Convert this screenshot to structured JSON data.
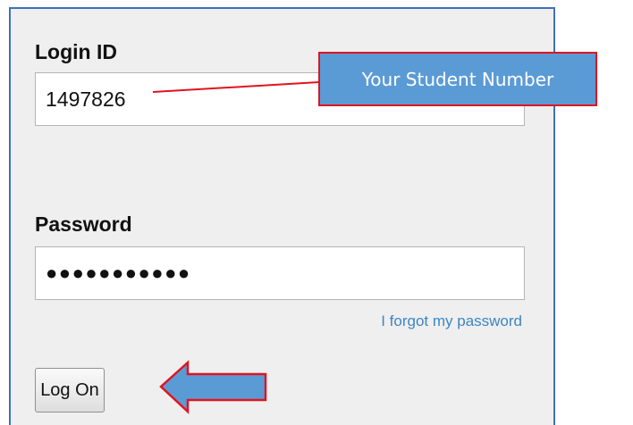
{
  "form": {
    "login_label": "Login ID",
    "login_value": "1497826",
    "password_label": "Password",
    "password_value": "●●●●●●●●●●●",
    "forgot_link": "I forgot my password",
    "logon_button": "Log On"
  },
  "annotation": {
    "callout_text": "Your Student Number",
    "arrow_direction": "left",
    "arrow_fill": "#5b9bd5",
    "outline_color": "#e0141f"
  },
  "colors": {
    "panel_background": "#efefef",
    "panel_border": "#3f72b7",
    "link": "#3a86c4"
  }
}
